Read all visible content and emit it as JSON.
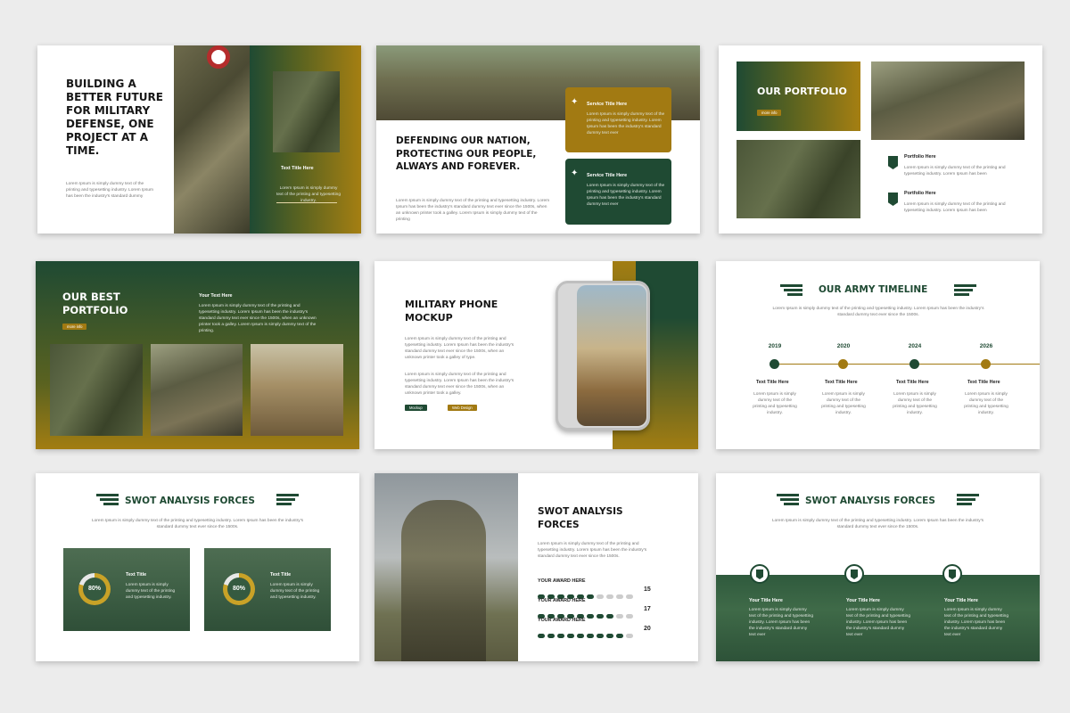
{
  "slides": {
    "s1": {
      "title": "BUILDING A BETTER FUTURE FOR MILITARY DEFENSE, ONE PROJECT AT A TIME.",
      "body": "Lorem Ipsum is simply dummy text of the printing and typesetting industry. Lorem Ipsum has been the industry's standard dummy",
      "card_title": "Text Title Here",
      "card_body": "Lorem Ipsum is simply dummy text of the printing and typesetting industry."
    },
    "s2": {
      "title": "DEFENDING OUR NATION, PROTECTING OUR PEOPLE, ALWAYS AND FOREVER.",
      "body": "Lorem Ipsum is simply dummy text of the printing and typesetting industry. Lorem Ipsum has been the industry's standard dummy text ever since the 1500s, when an unknown printer took a galley. Lorem Ipsum is simply dummy text of the printing",
      "card1_title": "Service Title Here",
      "card1_body": "Lorem Ipsum is simply dummy text of the printing and typesetting industry. Lorem Ipsum has been the industry's standard dummy text ever",
      "card2_title": "Service Title Here",
      "card2_body": "Lorem Ipsum is simply dummy text of the printing and typesetting industry. Lorem Ipsum has been the industry's standard dummy text ever"
    },
    "s3": {
      "title": "OUR PORTFOLIO",
      "pill": "more info",
      "item1_title": "Portfolio Here",
      "item1_body": "Lorem Ipsum is simply dummy text of the printing and typesetting industry. Lorem Ipsum has been",
      "item2_title": "Portfolio Here",
      "item2_body": "Lorem Ipsum is simply dummy text of the printing and typesetting industry. Lorem Ipsum has been"
    },
    "s4": {
      "title": "OUR BEST PORTFOLIO",
      "pill": "more info",
      "sub_title": "Your Text Here",
      "body": "Lorem Ipsum is simply dummy text of the printing and typesetting industry. Lorem Ipsum has been the industry's standard dummy text ever since the 1500s, when an unknown printer took a galley. Lorem Ipsum is simply dummy text of the printing."
    },
    "s5": {
      "title": "MILITARY PHONE MOCKUP",
      "body1": "Lorem Ipsum is simply dummy text of the printing and typesetting industry. Lorem Ipsum has been the industry's standard dummy text ever since the 1500s, when an unknown printer took a galley of type.",
      "body2": "Lorem Ipsum is simply dummy text of the printing and typesetting industry. Lorem Ipsum has been the industry's standard dummy text ever since the 1500s, when an unknown printer took a galley.",
      "btn1": "Mockup",
      "btn2": "Web Design"
    },
    "s6": {
      "title": "OUR ARMY TIMELINE",
      "body": "Lorem Ipsum is simply dummy text of the printing and typesetting industry. Lorem Ipsum has been the industry's standard dummy text ever since the 1500s.",
      "years": [
        "2019",
        "2020",
        "2024",
        "2026"
      ],
      "item_title": "Text Title Here",
      "item_body": "Lorem Ipsum is simply dummy text of the printing and typesetting industry."
    },
    "s7": {
      "title": "SWOT ANALYSIS FORCES",
      "body": "Lorem Ipsum is simply dummy text of the printing and typesetting industry. Lorem Ipsum has been the industry's standard dummy text ever since the 1500s.",
      "percent": "80%",
      "card_title": "Text Title",
      "card_body": "Lorem Ipsum is simply dummy text of the printing and typesetting industry."
    },
    "s8": {
      "title": "SWOT ANALYSIS FORCES",
      "body": "Lorem Ipsum is simply dummy text of the printing and typesetting industry. Lorem Ipsum has been the industry's standard dummy text ever since the 1500s.",
      "awards": [
        {
          "label": "YOUR AWARD HERE",
          "value": "15",
          "level": 0.5
        },
        {
          "label": "YOUR AWARD HERE",
          "value": "17",
          "level": 0.8
        },
        {
          "label": "YOUR AWARD HERE",
          "value": "20",
          "level": 0.95
        }
      ]
    },
    "s9": {
      "title": "SWOT ANALYSIS FORCES",
      "body": "Lorem Ipsum is simply dummy text of the printing and typesetting industry. Lorem Ipsum has been the industry's standard dummy text ever since the 1500s.",
      "item_title": "Your Title Here",
      "item_body": "Lorem Ipsum is simply dummy text of the printing and typesetting industry. Lorem Ipsum has been the industry's standard dummy text ever"
    }
  },
  "colors": {
    "green": "#1f4a33",
    "gold": "#a27a12",
    "background": "#ececec"
  }
}
